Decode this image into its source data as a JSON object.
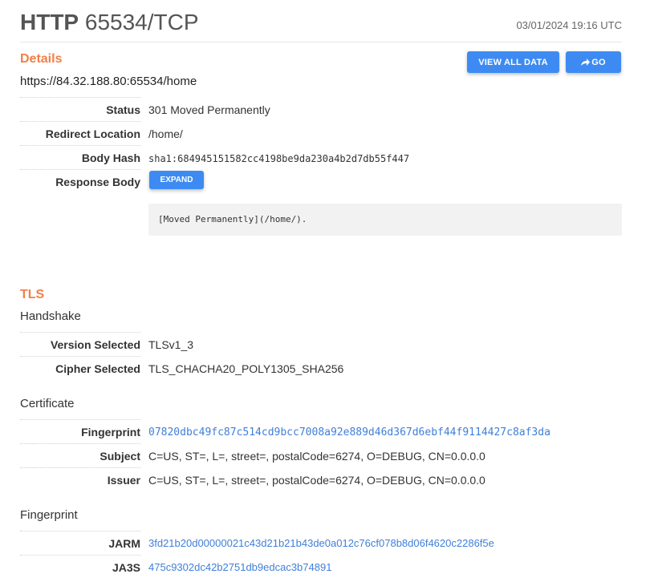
{
  "header": {
    "protocol": "HTTP",
    "port": "65534/TCP",
    "timestamp": "03/01/2024 19:16 UTC"
  },
  "details": {
    "heading": "Details",
    "url": "https://84.32.188.80:65534/home",
    "buttons": {
      "view_all": "VIEW ALL DATA",
      "go": "GO"
    },
    "rows": [
      {
        "key": "Status",
        "value": "301  Moved Permanently"
      },
      {
        "key": "Redirect Location",
        "value": "/home/"
      },
      {
        "key": "Body Hash",
        "value": "sha1:684945151582cc4198be9da230a4b2d7db55f447"
      },
      {
        "key": "Response Body",
        "value": ""
      }
    ],
    "expand_label": "EXPAND",
    "response_body": "[Moved Permanently](/home/)."
  },
  "tls": {
    "heading": "TLS",
    "handshake": {
      "heading": "Handshake",
      "rows": [
        {
          "key": "Version Selected",
          "value": "TLSv1_3"
        },
        {
          "key": "Cipher Selected",
          "value": "TLS_CHACHA20_POLY1305_SHA256"
        }
      ]
    },
    "certificate": {
      "heading": "Certificate",
      "rows": [
        {
          "key": "Fingerprint",
          "value": "07820dbc49fc87c514cd9bcc7008a92e889d46d367d6ebf44f9114427c8af3da"
        },
        {
          "key": "Subject",
          "value": "C=US, ST=, L=, street=, postalCode=6274, O=DEBUG, CN=0.0.0.0"
        },
        {
          "key": "Issuer",
          "value": "C=US, ST=, L=, street=, postalCode=6274, O=DEBUG, CN=0.0.0.0"
        }
      ]
    },
    "fingerprint": {
      "heading": "Fingerprint",
      "rows": [
        {
          "key": "JARM",
          "value": "3fd21b20d00000021c43d21b21b43de0a012c76cf078b8d06f4620c2286f5e"
        },
        {
          "key": "JA3S",
          "value": "475c9302dc42b2751db9edcac3b74891"
        }
      ]
    }
  },
  "colors": {
    "accent": "#f37f48",
    "button": "#3d8bf2",
    "link": "#3f7fd9"
  },
  "icons": {
    "go": "share-arrow-icon"
  }
}
